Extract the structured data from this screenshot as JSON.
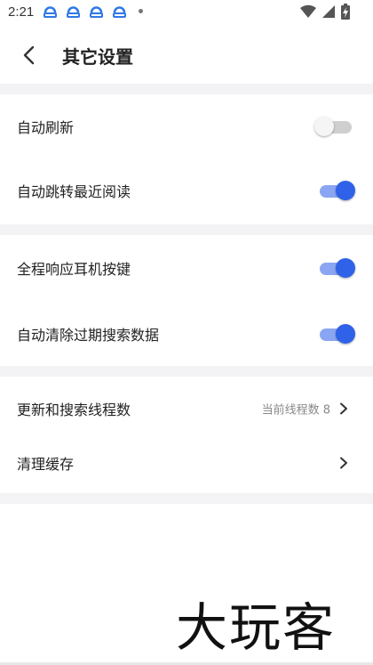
{
  "status_bar": {
    "time": "2:21",
    "notification_icons": [
      "baidu-netdisk-icon",
      "baidu-netdisk-icon",
      "baidu-netdisk-icon",
      "baidu-netdisk-icon"
    ],
    "right_icons": [
      "wifi-icon",
      "signal-icon",
      "battery-charging-icon"
    ]
  },
  "header": {
    "title": "其它设置"
  },
  "sections": [
    {
      "items": [
        {
          "label": "自动刷新",
          "toggle": false
        },
        {
          "label": "自动跳转最近阅读",
          "toggle": true
        }
      ]
    },
    {
      "items": [
        {
          "label": "全程响应耳机按键",
          "toggle": true
        },
        {
          "label": "自动清除过期搜索数据",
          "toggle": true
        }
      ]
    },
    {
      "items": [
        {
          "label": "更新和搜索线程数",
          "value": "当前线程数 8"
        },
        {
          "label": "清理缓存"
        }
      ]
    }
  ],
  "watermark": "大玩客",
  "colors": {
    "accent": "#2f62e8",
    "accent_track": "#8aa6f2",
    "section_gap": "#f3f3f5"
  }
}
